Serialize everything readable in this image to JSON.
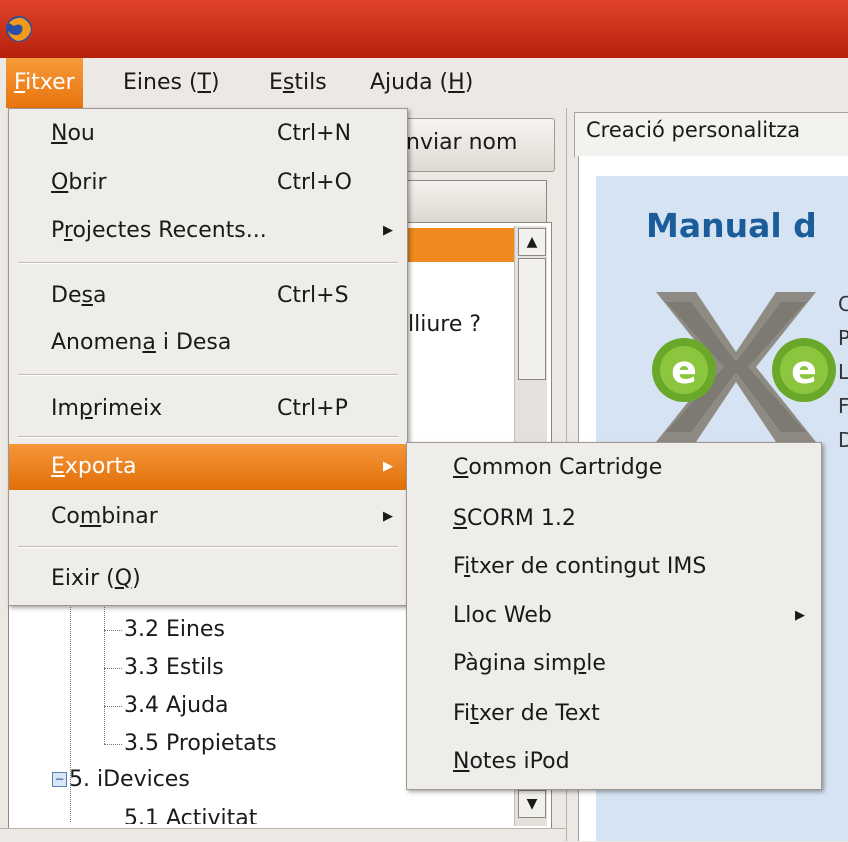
{
  "menubar": {
    "items": [
      {
        "pre": "",
        "key": "F",
        "post": "itxer"
      },
      {
        "pre": "Eines (",
        "key": "T",
        "post": ")"
      },
      {
        "pre": "E",
        "key": "s",
        "post": "tils"
      },
      {
        "pre": "Ajuda (",
        "key": "H",
        "post": ")"
      }
    ]
  },
  "file_menu": {
    "items": [
      {
        "pre": "",
        "key": "N",
        "post": "ou",
        "accel": "Ctrl+N"
      },
      {
        "pre": "",
        "key": "O",
        "post": "brir",
        "accel": "Ctrl+O"
      },
      {
        "pre": "P",
        "key": "r",
        "post": "ojectes Recents...",
        "accel": ""
      },
      {
        "pre": "De",
        "key": "s",
        "post": "a",
        "accel": "Ctrl+S"
      },
      {
        "pre": "Anomen",
        "key": "a",
        "post": " i Desa",
        "accel": ""
      },
      {
        "pre": "Im",
        "key": "p",
        "post": "rimeix",
        "accel": "Ctrl+P"
      },
      {
        "pre": "",
        "key": "E",
        "post": "xporta",
        "accel": ""
      },
      {
        "pre": "Co",
        "key": "m",
        "post": "binar",
        "accel": ""
      },
      {
        "pre": "Eixir (",
        "key": "Q",
        "post": ")",
        "accel": ""
      }
    ]
  },
  "export_submenu": {
    "items": [
      {
        "pre": "",
        "key": "C",
        "post": "ommon Cartridge"
      },
      {
        "pre": "",
        "key": "S",
        "post": "CORM 1.2"
      },
      {
        "pre": "F",
        "key": "i",
        "post": "txer de contingut IMS"
      },
      {
        "pre": "Lloc Web",
        "key": "",
        "post": ""
      },
      {
        "pre": "Pàgina sim",
        "key": "p",
        "post": "le"
      },
      {
        "pre": "Fi",
        "key": "t",
        "post": "xer de Text"
      },
      {
        "pre": "",
        "key": "N",
        "post": "otes iPod"
      }
    ]
  },
  "left_pane": {
    "rename_button": "nviar nom",
    "partial_item": "lliure ?",
    "tree": [
      "3.2 Eines",
      "3.3 Estils",
      "3.4 Ajuda",
      "3.5 Propietats",
      "5. iDevices",
      "5.1 Activitat"
    ]
  },
  "right_pane": {
    "tab_label": "Creació personalitza",
    "title": "Manual d",
    "side_letters": [
      "C",
      "P",
      "L",
      "F",
      "D"
    ]
  },
  "icons": {
    "app": "firefox-globe-icon",
    "logo": "exe-logo"
  },
  "colors": {
    "titlebar": "#c8280f",
    "accent": "#f08a1e",
    "heading": "#1b5c9b",
    "logo_green": "#6aa82a"
  }
}
